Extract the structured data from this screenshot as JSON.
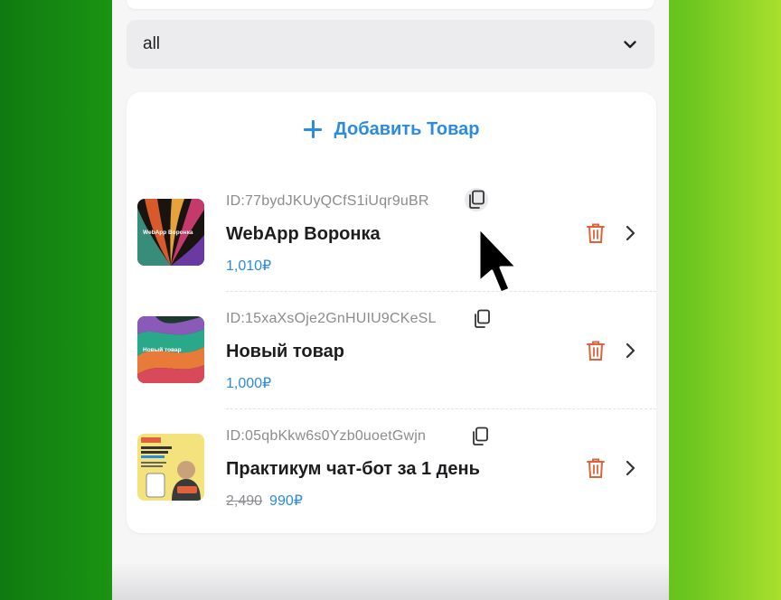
{
  "filter": {
    "selected": "all"
  },
  "card": {
    "add_label": "Добавить Товар",
    "items": [
      {
        "id": "ID:77bydJKUyQCfS1iUqr9uBR",
        "title": "WebApp Воронка",
        "price": "1,010₽",
        "old_price": "",
        "thumb_caption": "WebApp Воронка"
      },
      {
        "id": "ID:15xaXsOje2GnHUIU9CKeSL",
        "title": "Новый товар",
        "price": "1,000₽",
        "old_price": "",
        "thumb_caption": "Новый товар"
      },
      {
        "id": "ID:05qbKkw6s0Yzb0uoetGwjn",
        "title": "Практикум чат-бот за 1 день",
        "price": "990₽",
        "old_price": "2,490"
      }
    ]
  },
  "colors": {
    "accent": "#2a8be0",
    "delete": "#e0623a",
    "background_green": "#2aa815"
  },
  "icons": [
    "chevron-down-icon",
    "plus-icon",
    "copy-icon",
    "trash-icon",
    "chevron-right-icon",
    "cursor-arrow-icon"
  ]
}
